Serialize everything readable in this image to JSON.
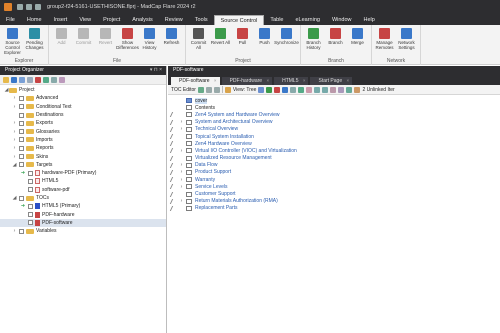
{
  "window": {
    "title": "group2-f24-5161-USETHISONE.flprj - MadCap Flare 2024 r2"
  },
  "menu_tabs": [
    "File",
    "Home",
    "Insert",
    "View",
    "Project",
    "Analysis",
    "Review",
    "Tools",
    "Source Control",
    "Table",
    "eLearning",
    "Window",
    "Help"
  ],
  "ribbon": {
    "groups": [
      {
        "label": "Explorer",
        "buttons": [
          {
            "label": "Source Control Explorer",
            "icon": "source-control-explorer-icon"
          },
          {
            "label": "Pending Changes",
            "icon": "pending-changes-icon"
          }
        ]
      },
      {
        "label": "File",
        "buttons": [
          {
            "label": "Add",
            "icon": "add-icon",
            "disabled": true
          },
          {
            "label": "Commit",
            "icon": "commit-icon",
            "disabled": true
          },
          {
            "label": "Revert",
            "icon": "revert-icon",
            "disabled": true
          },
          {
            "label": "Show Differences",
            "icon": "show-differences-icon"
          },
          {
            "label": "View History",
            "icon": "view-history-icon"
          },
          {
            "label": "Refresh",
            "icon": "refresh-icon"
          }
        ]
      },
      {
        "label": "Project",
        "buttons": [
          {
            "label": "Commit All",
            "icon": "commit-all-icon"
          },
          {
            "label": "Revert All",
            "icon": "revert-all-icon"
          },
          {
            "label": "Pull",
            "icon": "pull-icon"
          },
          {
            "label": "Push",
            "icon": "push-icon"
          },
          {
            "label": "Synchronize",
            "icon": "synchronize-icon"
          }
        ]
      },
      {
        "label": "Branch",
        "buttons": [
          {
            "label": "Branch History",
            "icon": "branch-history-icon"
          },
          {
            "label": "Branch",
            "icon": "branch-icon"
          },
          {
            "label": "Merge",
            "icon": "merge-icon"
          }
        ]
      },
      {
        "label": "Network",
        "buttons": [
          {
            "label": "Manage Remotes",
            "icon": "manage-remotes-icon"
          },
          {
            "label": "Network Settings",
            "icon": "network-settings-icon"
          }
        ]
      }
    ]
  },
  "left_panel": {
    "title": "Project Organizer",
    "controls": "▾ ⊓ ×",
    "tree": [
      {
        "label": "Project",
        "level": 0,
        "type": "folder",
        "arrow": "◢",
        "check": false
      },
      {
        "label": "Advanced",
        "level": 1,
        "type": "folder",
        "arrow": "›",
        "check": true
      },
      {
        "label": "Conditional Text",
        "level": 1,
        "type": "folder",
        "arrow": "›",
        "check": true
      },
      {
        "label": "Destinations",
        "level": 1,
        "type": "folder",
        "arrow": "",
        "check": true
      },
      {
        "label": "Exports",
        "level": 1,
        "type": "folder",
        "arrow": "›",
        "check": true
      },
      {
        "label": "Glossaries",
        "level": 1,
        "type": "folder",
        "arrow": "›",
        "check": true
      },
      {
        "label": "Imports",
        "level": 1,
        "type": "folder",
        "arrow": "›",
        "check": true
      },
      {
        "label": "Reports",
        "level": 1,
        "type": "folder",
        "arrow": "›",
        "check": true
      },
      {
        "label": "Skins",
        "level": 1,
        "type": "folder",
        "arrow": "›",
        "check": true
      },
      {
        "label": "Targets",
        "level": 1,
        "type": "folder",
        "arrow": "◢",
        "check": true
      },
      {
        "label": "hardware-PDF (Primary)",
        "level": 2,
        "type": "target",
        "mark": "➜",
        "check": true
      },
      {
        "label": "HTML5",
        "level": 2,
        "type": "target",
        "check": true
      },
      {
        "label": "software-pdf",
        "level": 2,
        "type": "target",
        "check": true
      },
      {
        "label": "TOCs",
        "level": 1,
        "type": "folder",
        "arrow": "◢",
        "check": true
      },
      {
        "label": "HTML5 (Primary)",
        "level": 2,
        "type": "toc-blue",
        "mark": "➜",
        "check": true
      },
      {
        "label": "PDF-hardware",
        "level": 2,
        "type": "toc-red",
        "check": true
      },
      {
        "label": "PDF-software",
        "level": 2,
        "type": "toc-red",
        "check": true,
        "selected": true
      },
      {
        "label": "Variables",
        "level": 1,
        "type": "folder",
        "arrow": "›",
        "check": true
      }
    ]
  },
  "right_panel": {
    "title": "PDF-software",
    "tabs": [
      {
        "label": "PDF-software",
        "active": true
      },
      {
        "label": "PDF-hardware",
        "active": false
      },
      {
        "label": "HTML5",
        "active": false
      },
      {
        "label": "Start Page",
        "active": false
      }
    ],
    "toolbar": {
      "editor_label": "TOC Editor",
      "view_label": "View: Tree",
      "unlinked_label": "2 Unlinked Iter"
    },
    "entries": [
      {
        "label": "cover",
        "link": false,
        "expand": false,
        "book": "blue",
        "highlight": true
      },
      {
        "label": "Contents",
        "link": false,
        "expand": false,
        "book": "plain"
      },
      {
        "label": "Zen4 System and Hardware Overview",
        "link": true,
        "expand": false,
        "book": "plain"
      },
      {
        "label": "System and Architectural Overview",
        "link": true,
        "expand": true,
        "book": "plain"
      },
      {
        "label": "Technical Overview",
        "link": true,
        "expand": true,
        "book": "plain"
      },
      {
        "label": "Topical System Installation",
        "link": true,
        "expand": false,
        "book": "plain"
      },
      {
        "label": "Zen4 Hardware Overview",
        "link": true,
        "expand": false,
        "book": "plain"
      },
      {
        "label": "Virtual I/O Controller (VIOC) and Virtualization",
        "link": true,
        "expand": true,
        "book": "plain"
      },
      {
        "label": "Virtualized Resource Management",
        "link": true,
        "expand": false,
        "book": "plain"
      },
      {
        "label": "Data Flow",
        "link": true,
        "expand": true,
        "book": "plain"
      },
      {
        "label": "Product Support",
        "link": true,
        "expand": true,
        "book": "plain"
      },
      {
        "label": "Warranty",
        "link": true,
        "expand": true,
        "book": "plain"
      },
      {
        "label": "Service Levels",
        "link": true,
        "expand": true,
        "book": "plain"
      },
      {
        "label": "Customer Support",
        "link": true,
        "expand": false,
        "book": "plain"
      },
      {
        "label": "Return Materials Authorization (RMA)",
        "link": true,
        "expand": true,
        "book": "plain"
      },
      {
        "label": "Replacement Parts",
        "link": true,
        "expand": false,
        "book": "plain"
      }
    ]
  },
  "colors": {
    "titlebar": "#2d2d30",
    "ribbon": "#f3f3f3",
    "link_text": "#2a5db0",
    "folder": "#e6b94b",
    "selection": "#dbe3ee"
  }
}
